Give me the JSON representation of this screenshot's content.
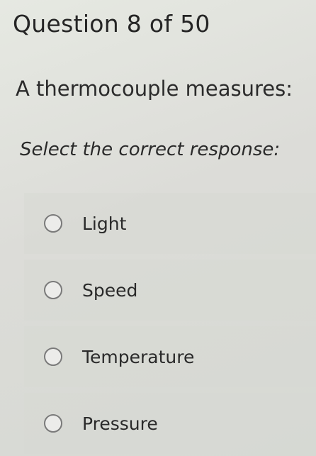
{
  "quiz": {
    "counter": "Question 8 of 50",
    "question": "A thermocouple measures:",
    "prompt": "Select the correct response:",
    "options": [
      {
        "label": "Light"
      },
      {
        "label": "Speed"
      },
      {
        "label": "Temperature"
      },
      {
        "label": "Pressure"
      }
    ]
  }
}
